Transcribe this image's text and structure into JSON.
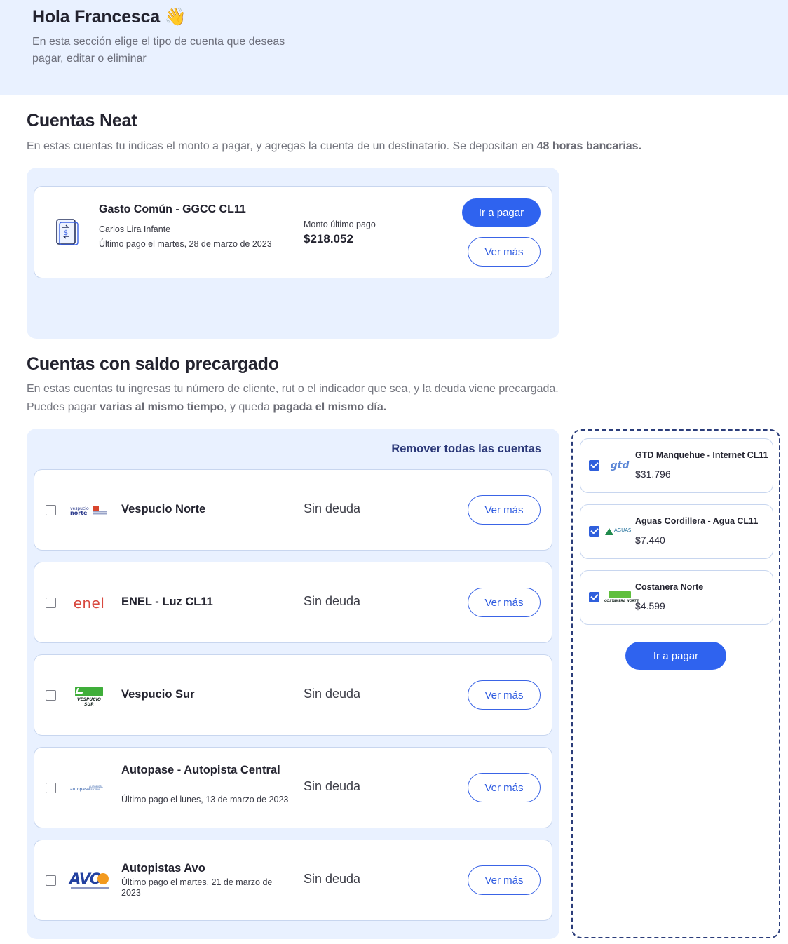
{
  "header": {
    "greeting": "Hola Francesca 👋",
    "subtitle": "En esta sección elige el tipo de cuenta que deseas pagar, editar o eliminar"
  },
  "neat": {
    "title": "Cuentas Neat",
    "desc_plain": "En estas cuentas tu indicas el monto a pagar, y agregas la cuenta de un destinatario. Se depositan en ",
    "desc_bold": "48 horas bancarias.",
    "card": {
      "icon": "document-dollar-icon",
      "name": "Gasto Común - GGCC CL11",
      "holder": "Carlos Lira Infante",
      "last_payment": "Último pago el martes, 28 de marzo de 2023",
      "amount_label": "Monto último pago",
      "amount": "$218.052",
      "pay_label": "Ir a pagar",
      "more_label": "Ver más"
    }
  },
  "precharged": {
    "title": "Cuentas con saldo precargado",
    "desc_line1": "En estas cuentas tu ingresas tu número de cliente, rut o el indicador que sea, y la deuda viene precargada.",
    "desc2_a": "Puedes pagar ",
    "desc2_b": "varias al mismo tiempo",
    "desc2_c": ", y queda ",
    "desc2_d": "pagada el mismo día.",
    "remove_all": "Remover todas las cuentas",
    "accounts": [
      {
        "logo": "vespucio-norte-logo",
        "name": "Vespucio Norte",
        "status": "Sin deuda",
        "more": "Ver más"
      },
      {
        "logo": "enel-logo",
        "logo_text": "enel",
        "name": "ENEL - Luz CL11",
        "status": "Sin deuda",
        "more": "Ver más"
      },
      {
        "logo": "vespucio-sur-logo",
        "logo_text": "VESPUCIO SUR",
        "name": "Vespucio Sur",
        "status": "Sin deuda",
        "more": "Ver más"
      },
      {
        "logo": "autopase-logo",
        "name": "Autopase - Autopista Central",
        "last_payment": "Último pago el lunes, 13 de marzo de 2023",
        "status": "Sin deuda",
        "more": "Ver más"
      },
      {
        "logo": "avo-logo",
        "logo_text": "AVO",
        "name": "Autopistas Avo",
        "last_payment": "Último pago el martes, 21 de marzo de 2023",
        "status": "Sin deuda",
        "more": "Ver más"
      }
    ]
  },
  "cart": {
    "items": [
      {
        "logo": "gtd-logo",
        "logo_text": "gtd",
        "name": "GTD Manquehue - Internet CL11",
        "amount": "$31.796",
        "checked": true
      },
      {
        "logo": "aguas-cordillera-logo",
        "logo_text": "AGUAS",
        "name": "Aguas Cordillera - Agua CL11",
        "amount": "$7.440",
        "checked": true
      },
      {
        "logo": "costanera-norte-logo",
        "logo_text": "COSTANERA NORTE",
        "name": "Costanera Norte",
        "amount": "$4.599",
        "checked": true
      }
    ],
    "pay_label": "Ir a pagar"
  },
  "colors": {
    "accent": "#2f63ef",
    "panel_bg": "#e9f1ff",
    "card_border": "#c8d6ef",
    "cart_border": "#2b3d7a"
  }
}
